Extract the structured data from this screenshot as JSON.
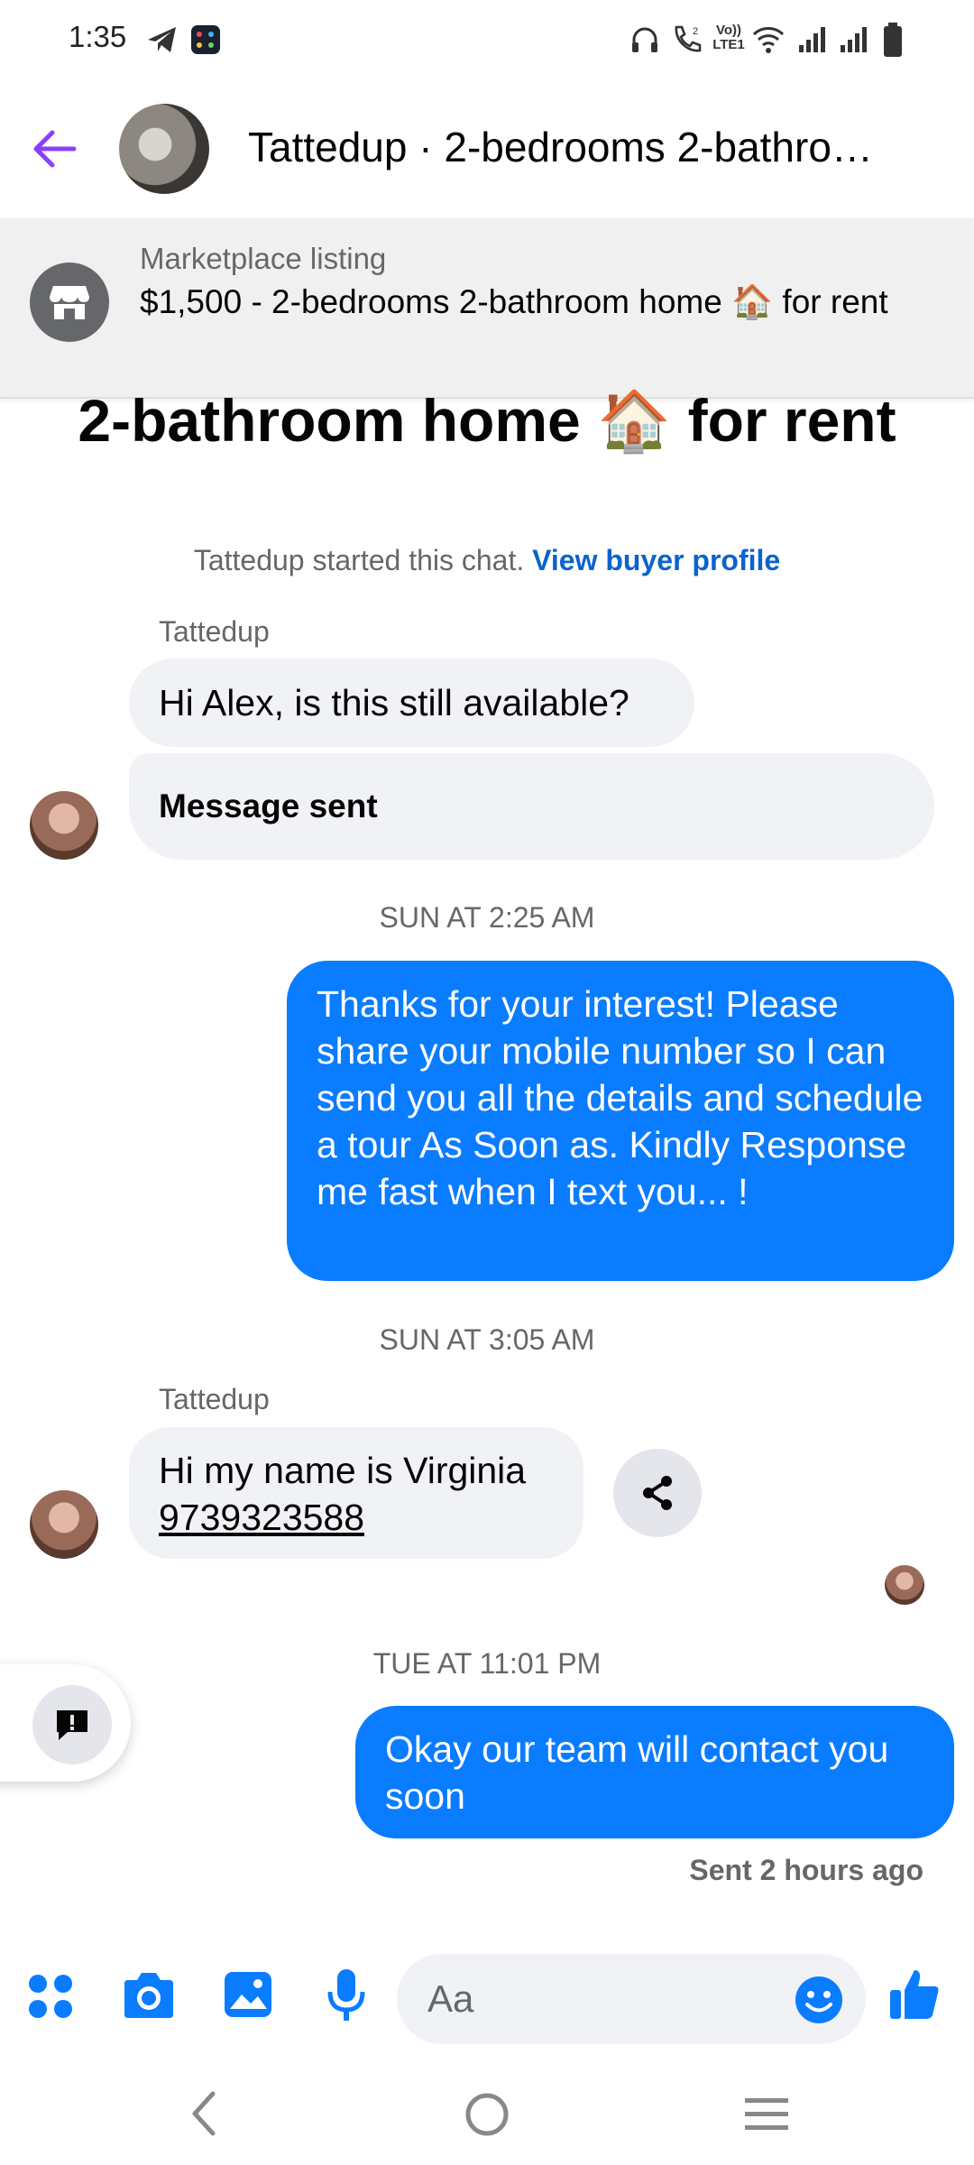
{
  "status_bar": {
    "time": "1:35",
    "icons": [
      "telegram-icon",
      "app-icon",
      "headphones-icon",
      "wifi-call-icon",
      "volte-icon",
      "wifi-icon",
      "signal-icon",
      "signal-icon",
      "battery-icon"
    ],
    "volte_text": "Vo)) LTE1"
  },
  "header": {
    "title": "Tattedup · 2-bedrooms 2-bathro…"
  },
  "listing_banner": {
    "label": "Marketplace listing",
    "title": "$1,500 - 2-bedrooms 2-bathroom home 🏠 for rent"
  },
  "chat": {
    "title_partial": "2-bathroom home 🏠 for rent",
    "system": {
      "text": "Tattedup started this chat.",
      "link": "View buyer profile"
    },
    "messages": [
      {
        "sender": "Tattedup",
        "text": "Hi Alex, is this still available?"
      },
      {
        "text": "Message sent"
      },
      {
        "separator": "SUN AT 2:25 AM"
      },
      {
        "text": "Thanks for your interest! Please share your mobile number so I can send you all the details and schedule a tour As Soon as. Kindly Response me fast when I text you... !"
      },
      {
        "separator": "SUN AT 3:05 AM"
      },
      {
        "sender": "Tattedup",
        "text_line1": "Hi my name is Virginia",
        "phone": "9739323588"
      },
      {
        "separator": "TUE AT 11:01 PM"
      },
      {
        "text": "Okay our team will contact you soon"
      }
    ],
    "sent_status": "Sent 2 hours ago"
  },
  "composer": {
    "placeholder": "Aa"
  },
  "colors": {
    "accent_blue": "#0a7cff",
    "back_arrow": "#8a3ffc",
    "incoming_bubble": "#f0f2f5",
    "link": "#0b63ce"
  }
}
